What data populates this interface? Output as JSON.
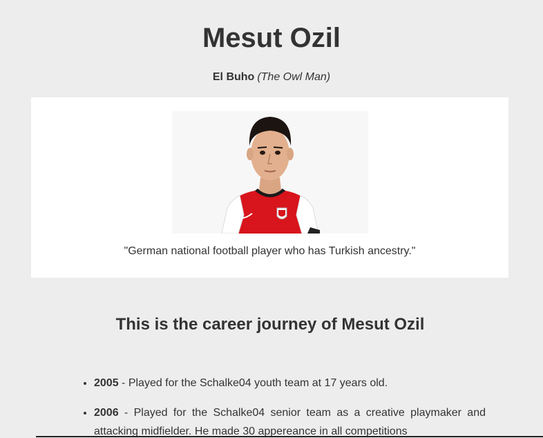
{
  "page": {
    "title": "Mesut Ozil",
    "nickname": "El Buho",
    "nickname_translation": "(The Owl Man)"
  },
  "image_card": {
    "photo_icon": "player-portrait",
    "caption": "\"German national football player who has Turkish ancestry.\""
  },
  "career": {
    "heading": "This is the career journey of Mesut Ozil",
    "items": [
      {
        "year": "2005",
        "text": " - Played for the Schalke04 youth team at 17 years old."
      },
      {
        "year": "2006",
        "text": " - Played for the Schalke04 senior team as a creative playmaker and attacking midfielder. He made 30 appereance in all competitions"
      }
    ]
  },
  "colors": {
    "background": "#ededed",
    "card": "#ffffff",
    "text": "#333333",
    "jersey_red": "#d8141c"
  }
}
